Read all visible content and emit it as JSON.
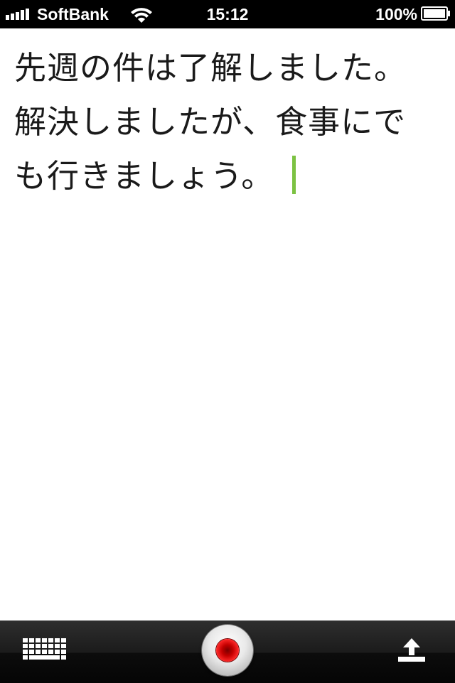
{
  "status_bar": {
    "carrier": "SoftBank",
    "time": "15:12",
    "battery_percent": "100%",
    "signal_icon": "signal-bars-icon",
    "wifi_icon": "wifi-icon",
    "battery_icon": "battery-full-icon"
  },
  "note": {
    "lines": [
      "先週の件は了解しました。",
      "解決しましたが、食事にで",
      "も行きましょう。"
    ],
    "cursor_color": "#7cc242"
  },
  "toolbar": {
    "keyboard_icon": "keyboard-icon",
    "record_icon": "record-icon",
    "share_icon": "share-upload-icon",
    "record_color": "#d40000"
  }
}
